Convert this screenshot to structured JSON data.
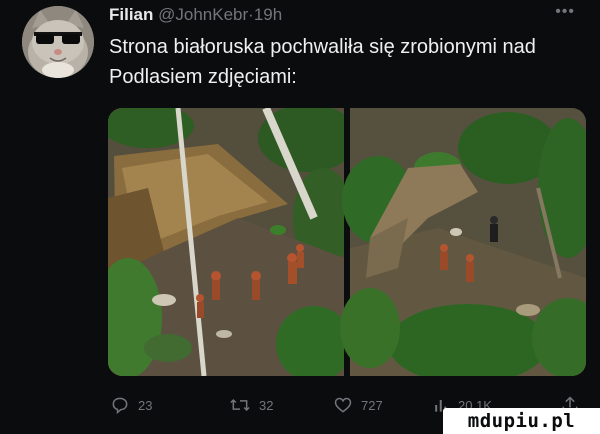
{
  "tweet": {
    "author_name": "Filian",
    "author_handle": "@JohnKebr",
    "separator": "·",
    "time": "19h",
    "text": "Strona białoruska pochwaliła się zrobionymi nad Podlasiem zdjęciami:"
  },
  "actions": {
    "reply_count": "23",
    "retweet_count": "32",
    "like_count": "727",
    "views_count": "20.1K"
  },
  "icons": {
    "more": "more-icon",
    "reply": "reply-icon",
    "retweet": "retweet-icon",
    "like": "heart-icon",
    "views": "views-icon",
    "share": "share-icon"
  },
  "watermark": "mdupiu.pl",
  "colors": {
    "background": "#0b0c0e",
    "text": "#e7e9ea",
    "muted": "#71767b"
  }
}
